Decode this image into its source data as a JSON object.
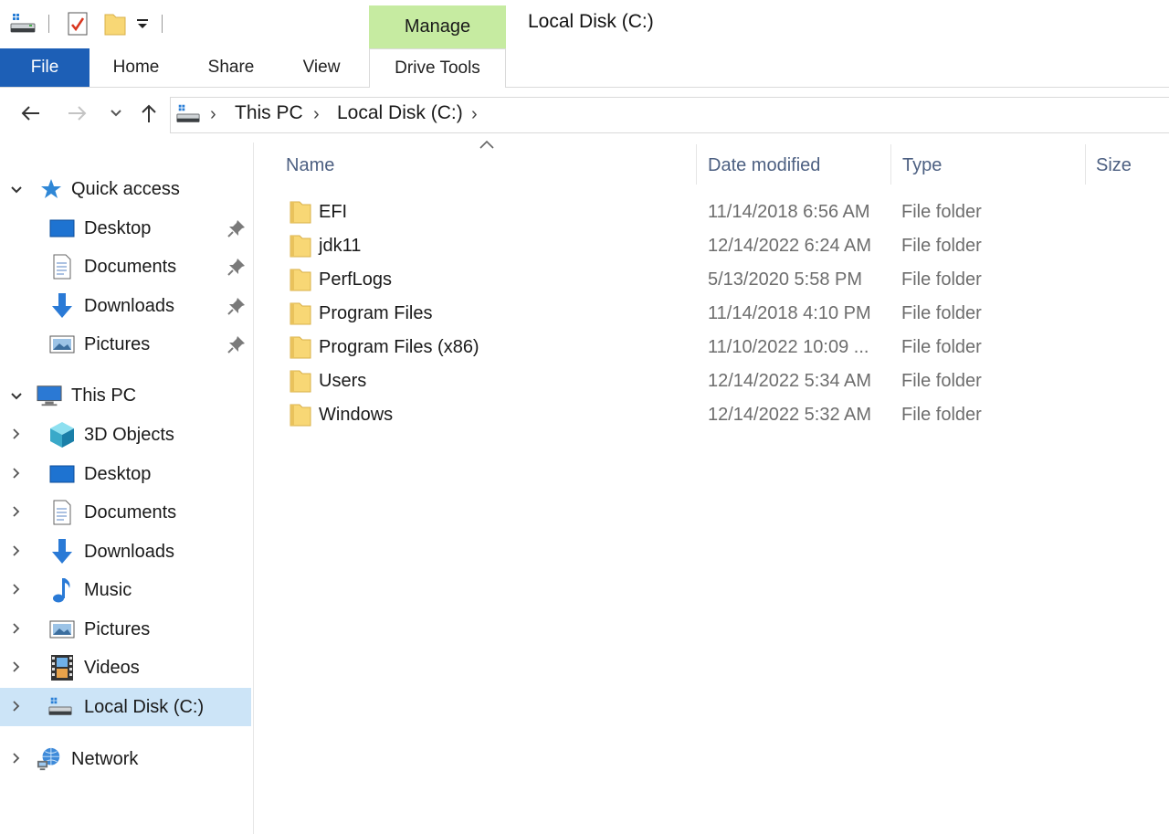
{
  "window": {
    "title": "Local Disk (C:)",
    "contextual_tab_group": "Manage"
  },
  "ribbon": {
    "tabs": [
      "File",
      "Home",
      "Share",
      "View",
      "Drive Tools"
    ]
  },
  "address": {
    "breadcrumbs": [
      "This PC",
      "Local Disk (C:)"
    ]
  },
  "nav": {
    "quick_access": {
      "label": "Quick access",
      "items": [
        "Desktop",
        "Documents",
        "Downloads",
        "Pictures"
      ]
    },
    "this_pc": {
      "label": "This PC",
      "items": [
        "3D Objects",
        "Desktop",
        "Documents",
        "Downloads",
        "Music",
        "Pictures",
        "Videos",
        "Local Disk (C:)"
      ]
    },
    "network": {
      "label": "Network"
    }
  },
  "columns": {
    "name": "Name",
    "date": "Date modified",
    "type": "Type",
    "size": "Size"
  },
  "files": [
    {
      "name": "EFI",
      "date": "11/14/2018 6:56 AM",
      "type": "File folder"
    },
    {
      "name": "jdk11",
      "date": "12/14/2022 6:24 AM",
      "type": "File folder"
    },
    {
      "name": "PerfLogs",
      "date": "5/13/2020 5:58 PM",
      "type": "File folder"
    },
    {
      "name": "Program Files",
      "date": "11/14/2018 4:10 PM",
      "type": "File folder"
    },
    {
      "name": "Program Files (x86)",
      "date": "11/10/2022 10:09 ...",
      "type": "File folder"
    },
    {
      "name": "Users",
      "date": "12/14/2022 5:34 AM",
      "type": "File folder"
    },
    {
      "name": "Windows",
      "date": "12/14/2022 5:32 AM",
      "type": "File folder"
    }
  ],
  "colors": {
    "accent": "#1d5fb6",
    "manage_tab": "#c6eba1",
    "selection": "#cce4f7",
    "folder": "#f8d775"
  },
  "icons": {
    "qat": [
      "drive-icon",
      "properties-icon",
      "new-folder-icon",
      "customize-qat-icon"
    ],
    "nav": [
      "star-icon",
      "desktop-icon",
      "documents-icon",
      "downloads-icon",
      "pictures-icon",
      "computer-icon",
      "3d-objects-icon",
      "music-icon",
      "videos-icon",
      "drive-icon",
      "network-icon",
      "pin-icon"
    ]
  }
}
